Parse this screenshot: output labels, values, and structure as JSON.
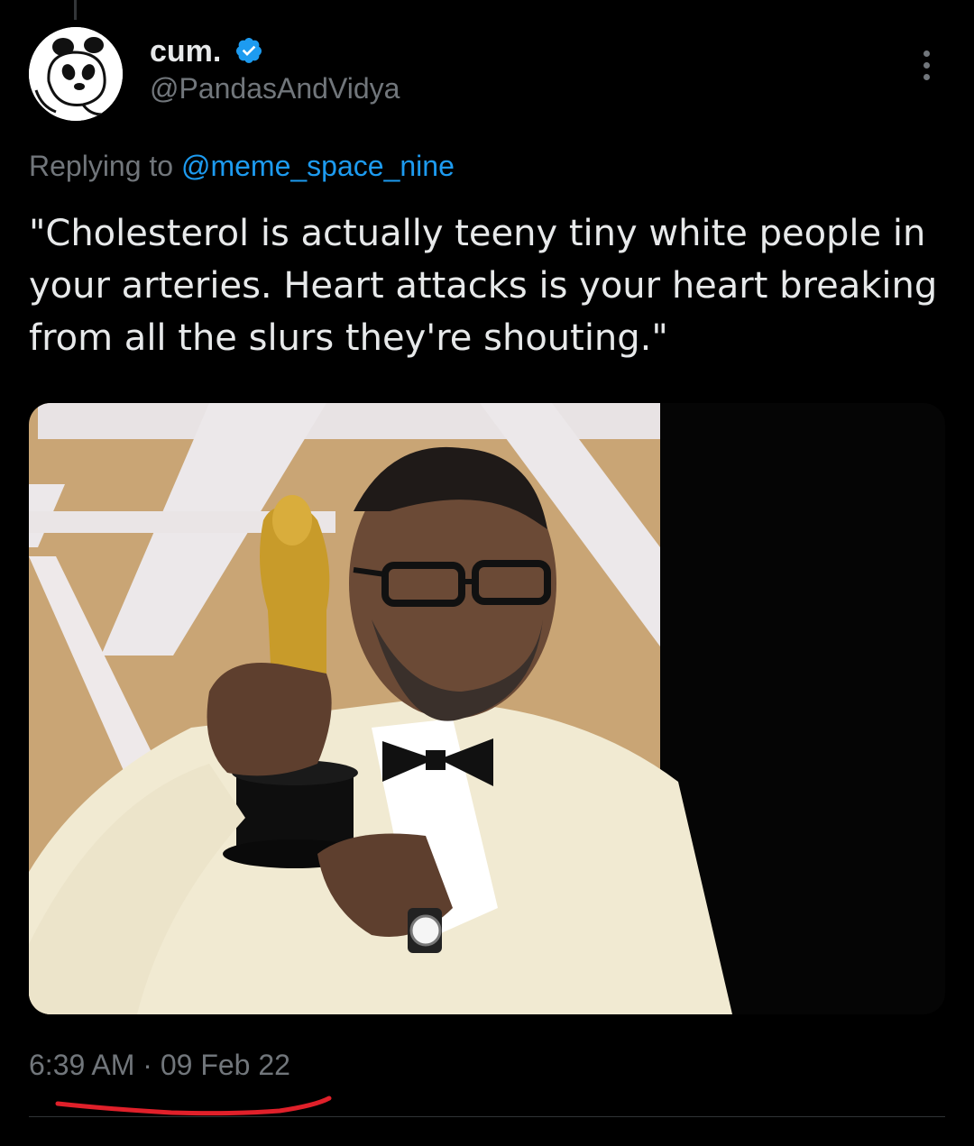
{
  "tweet": {
    "display_name": "cum.",
    "handle": "@PandasAndVidya",
    "verified": true,
    "avatar_icon": "panda-avatar-icon",
    "replying_to_label": "Replying to",
    "replying_to_handle": "@meme_space_nine",
    "text": "\"Cholesterol is actually teeny tiny white people in your arteries. Heart attacks is your heart breaking from all the slurs they're shouting.\"",
    "time": "6:39 AM",
    "separator": "·",
    "date": "09 Feb 22",
    "media_type": "photo"
  },
  "colors": {
    "background": "#000000",
    "text_primary": "#e7e9ea",
    "text_secondary": "#71767b",
    "link": "#1d9bf0",
    "verified_badge": "#1d9bf0",
    "annotation_underline": "#e0202a"
  }
}
